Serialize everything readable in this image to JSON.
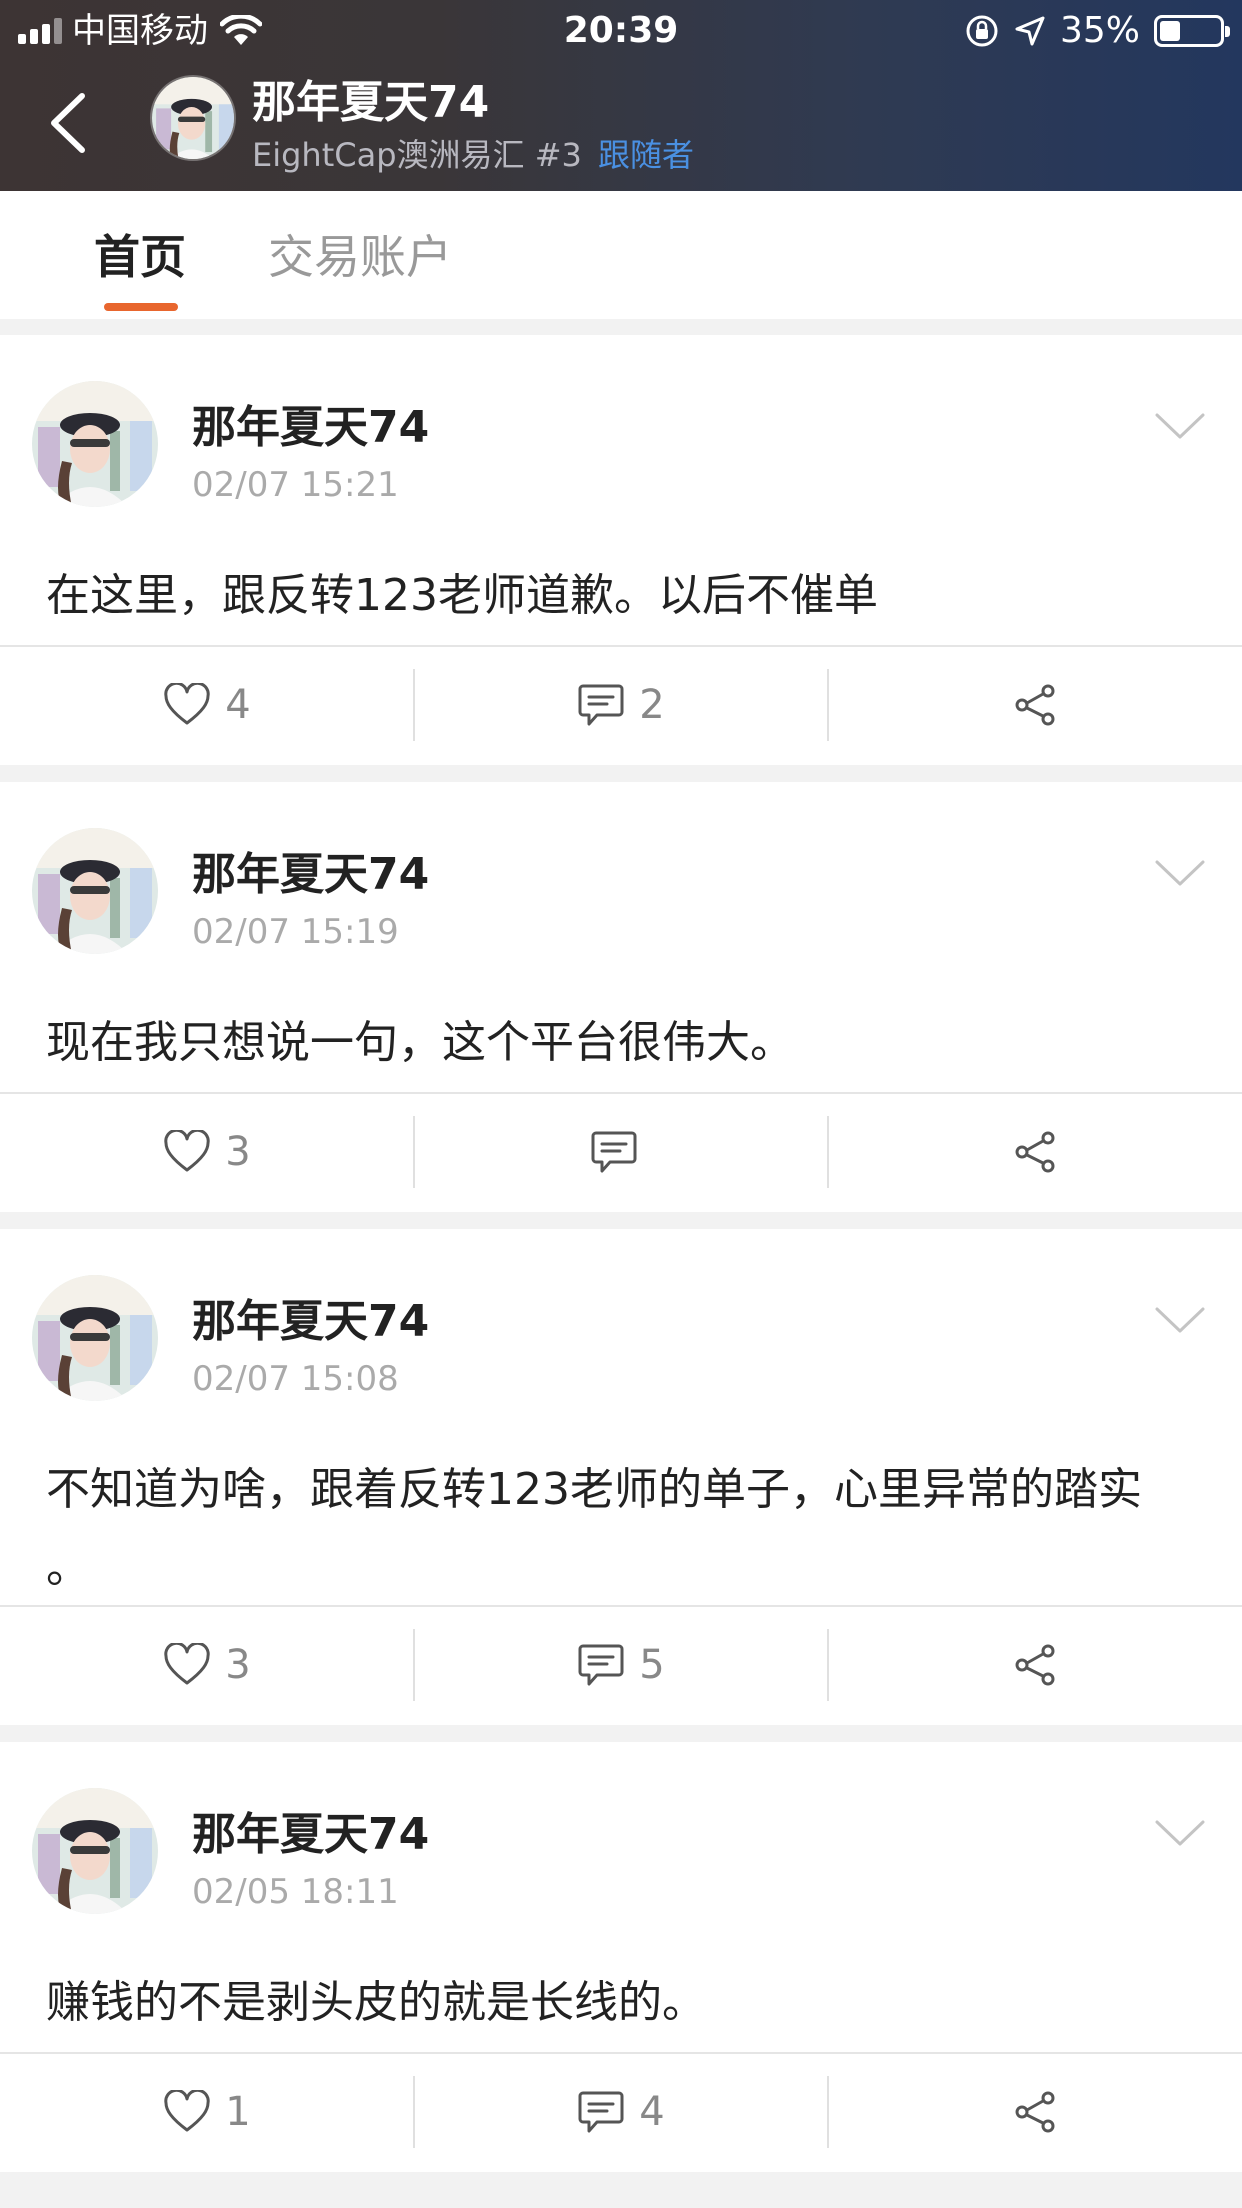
{
  "status_bar": {
    "carrier": "中国移动",
    "time": "20:39",
    "battery": "35%",
    "battery_level": 0.35,
    "signal_bars": 3
  },
  "nav": {
    "title": "那年夏天74",
    "subtitle": "EightCap澳洲易汇 #3",
    "follower_tag": "跟随者"
  },
  "tabs": [
    {
      "label": "首页",
      "active": true
    },
    {
      "label": "交易账户",
      "active": false
    }
  ],
  "posts": [
    {
      "author": "那年夏天74",
      "time": "02/07 15:21",
      "text": "在这里，跟反转123老师道歉。以后不催单",
      "likes": "4",
      "comments": "2"
    },
    {
      "author": "那年夏天74",
      "time": "02/07 15:19",
      "text": "现在我只想说一句，这个平台很伟大。",
      "likes": "3",
      "comments": ""
    },
    {
      "author": "那年夏天74",
      "time": "02/07 15:08",
      "text": "不知道为啥，跟着反转123老师的单子，心里异常的踏实",
      "text_line2": "。",
      "likes": "3",
      "comments": "5"
    },
    {
      "author": "那年夏天74",
      "time": "02/05 18:11",
      "text": "赚钱的不是剥头皮的就是长线的。",
      "likes": "1",
      "comments": "4"
    }
  ],
  "colors": {
    "accent": "#e8662e",
    "link": "#4a90e2",
    "header_dark": "#3d3434",
    "header_blue": "#23375e"
  }
}
